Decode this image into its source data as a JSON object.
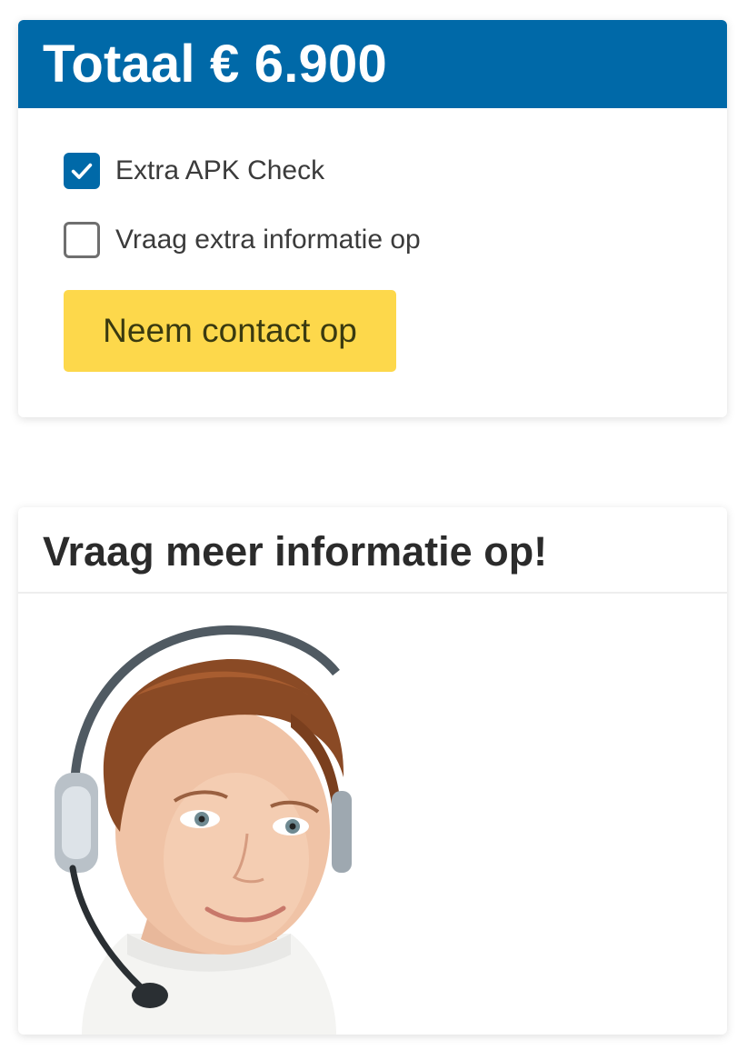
{
  "total_card": {
    "title": "Totaal € 6.900",
    "options": [
      {
        "label": "Extra APK Check",
        "checked": true
      },
      {
        "label": "Vraag extra informatie op",
        "checked": false
      }
    ],
    "contact_button": "Neem contact op"
  },
  "info_card": {
    "title": "Vraag meer informatie op!",
    "image_icon": "support-agent-headset-photo"
  },
  "colors": {
    "accent": "#0069a8",
    "button": "#fdd84b"
  }
}
